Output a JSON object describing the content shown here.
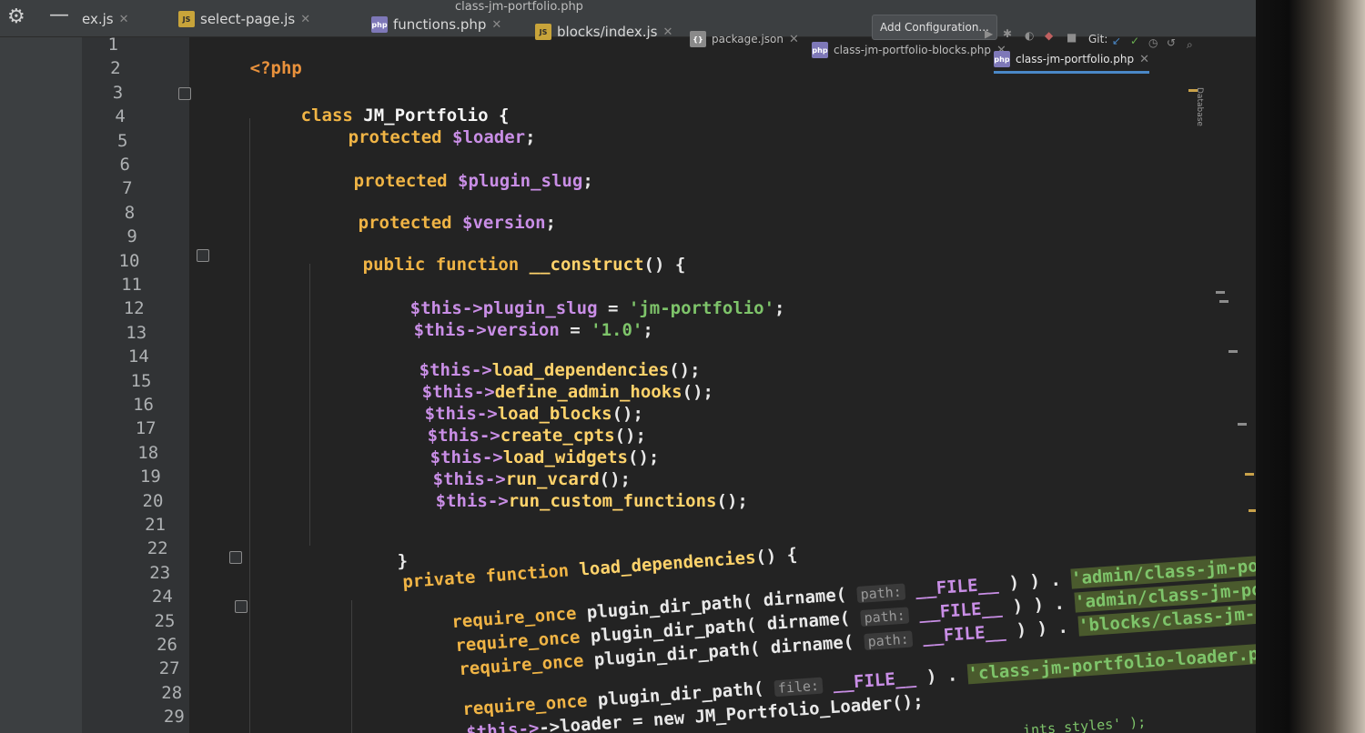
{
  "tabs": [
    {
      "label": "ex.js",
      "type": "js"
    },
    {
      "label": "select-page.js",
      "type": "js"
    },
    {
      "label": "functions.php",
      "type": "php"
    },
    {
      "label": "blocks/index.js",
      "type": "js"
    },
    {
      "label": "package.json",
      "type": "json"
    },
    {
      "label": "class-jm-portfolio-blocks.php",
      "type": "php"
    },
    {
      "label": "class-jm-portfolio.php",
      "type": "php",
      "active": true
    }
  ],
  "breadcrumb": "class-jm-portfolio.php",
  "toolbar": {
    "add_configuration": "Add Configuration...",
    "git_label": "Git:"
  },
  "side_panel_label": "Database",
  "line_numbers": [
    "1",
    "2",
    "3",
    "4",
    "5",
    "6",
    "7",
    "8",
    "9",
    "10",
    "11",
    "12",
    "13",
    "14",
    "15",
    "16",
    "17",
    "18",
    "19",
    "20",
    "21",
    "22",
    "23",
    "24",
    "25",
    "26",
    "27",
    "28",
    "29"
  ],
  "code": {
    "l1": "<?php",
    "l3a": "class",
    "l3b": " JM_Portfolio {",
    "l4a": "protected",
    "l4b": " $loader",
    ";": ";",
    "l6b": " $plugin_slug",
    "l8b": " $version",
    "l10a": "public function",
    "l10b": " __construct",
    "l10c": "() {",
    "l11a": "$this->",
    "l11b": "plugin_slug",
    " eq": " = ",
    "l11s": "'jm-portfolio'",
    "l12b": "version",
    "l12s": "'1.0'",
    "calls": [
      "load_dependencies",
      "define_admin_hooks",
      "load_blocks",
      "create_cpts",
      "load_widgets",
      "run_vcard",
      "run_custom_functions"
    ],
    "call_suffix": "();",
    "close": "}",
    "l23a": "private function",
    "l23b": " load_dependencies",
    "l23c": "() {",
    "req": "require_once",
    "pdp": " plugin_dir_path( dirname(",
    "hint_path": "path:",
    "hint_file": "file:",
    "file_const": "__FILE__",
    "close_parens": " ) ) . ",
    "r1s": "'admin/class-jm-portfolio-admin.php';",
    "r2s": "'admin/class-jm-portfolio-cpts.php';",
    "r3s": "'blocks/class-jm-portfolio-blocks.php';",
    "r4s": "'class-jm-portfolio-loader.php';",
    "pdp2": " plugin_dir_path(",
    "close_single": " ) . ",
    "l27": "->loader = new JM_Portfolio_Loader();",
    "l29tail": "ints_styles' );"
  },
  "colors": {
    "keyword": "#f0b445",
    "variable": "#c98ee6",
    "string": "#7ec46a",
    "background": "#232323"
  }
}
